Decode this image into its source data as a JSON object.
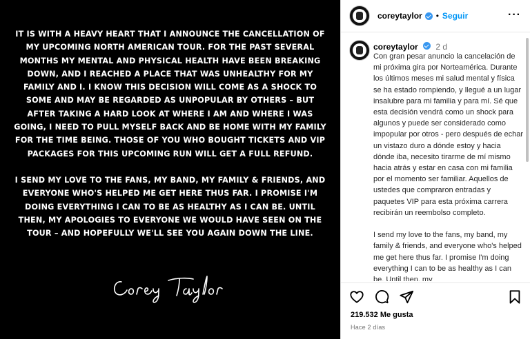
{
  "image": {
    "paragraphs": [
      "IT IS WITH A HEAVY HEART THAT I ANNOUNCE THE CANCELLATION OF MY UPCOMING NORTH AMERICAN TOUR. FOR THE PAST SEVERAL MONTHS MY MENTAL AND PHYSICAL HEALTH HAVE BEEN BREAKING DOWN, AND I REACHED A PLACE THAT WAS UNHEALTHY FOR MY FAMILY AND I. I KNOW THIS DECISION WILL COME AS A SHOCK TO SOME AND MAY BE REGARDED AS UNPOPULAR BY OTHERS – BUT AFTER TAKING A HARD LOOK AT WHERE I AM AND WHERE I WAS GOING, I NEED TO PULL MYSELF BACK AND BE HOME WITH MY FAMILY FOR THE TIME BEING. THOSE OF YOU WHO BOUGHT TICKETS AND VIP PACKAGES FOR THIS UPCOMING RUN WILL GET A FULL REFUND.",
      "I SEND MY LOVE TO THE FANS, MY BAND, MY FAMILY & FRIENDS, AND EVERYONE WHO'S HELPED ME GET HERE THUS FAR. I PROMISE I'M DOING EVERYTHING I CAN TO BE AS HEALTHY AS I CAN BE. UNTIL THEN, MY APOLOGIES TO EVERYONE WE WOULD HAVE SEEN ON THE TOUR – AND HOPEFULLY WE'LL SEE YOU AGAIN DOWN THE LINE."
    ],
    "signature": "Corey Taylor"
  },
  "header": {
    "username": "coreytaylor",
    "separator": "•",
    "follow_label": "Seguir",
    "more_label": "···"
  },
  "caption": {
    "username": "coreytaylor",
    "time": "2 d",
    "text": "Con gran pesar anuncio la cancelación de mi próxima gira por Norteamérica. Durante los últimos meses mi salud mental y física se ha estado rompiendo, y llegué a un lugar insalubre para mi familia y para mí. Sé que esta decisión vendrá como un shock para algunos y puede ser considerado como impopular por otros - pero después de echar un vistazo duro a dónde estoy y hacia dónde iba, necesito tirarme de mí mismo hacia atrás y estar en casa con mi familia por el momento ser familiar. Aquellos de ustedes que compraron entradas y paquetes VIP para esta próxima carrera recibirán un reembolso completo.\n\nI send my love to the fans, my band, my family & friends, and everyone who's helped me get here thus far. I promise I'm doing everything I can to be as healthy as I can be. Until then, my"
  },
  "footer": {
    "likes_count": "219.532",
    "likes_label": "Me gusta",
    "posted_ago": "Hace 2 días"
  },
  "icons": {
    "like": "heart-icon",
    "comment": "comment-icon",
    "share": "share-icon",
    "save": "bookmark-icon",
    "verified": "verified-badge-icon"
  },
  "colors": {
    "follow_blue": "#0095f6",
    "verified_blue": "#3897f0",
    "image_background": "#000000"
  }
}
